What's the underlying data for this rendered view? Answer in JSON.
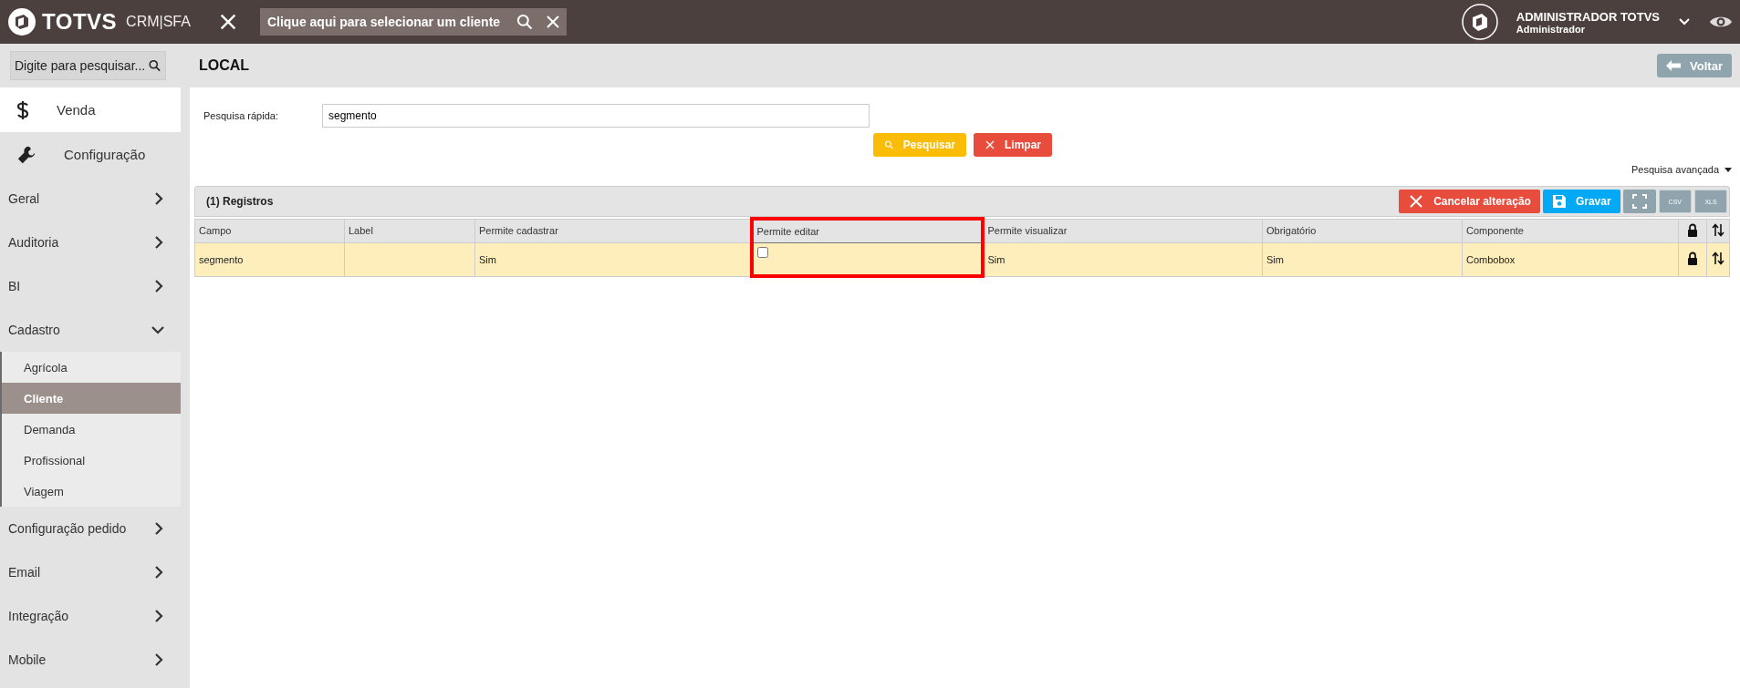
{
  "topbar": {
    "brand": "TOTVS",
    "product": "CRM|SFA",
    "client_search": {
      "placeholder": "Clique aqui para selecionar um cliente"
    },
    "user": {
      "name": "ADMINISTRADOR TOTVS",
      "role": "Administrador"
    }
  },
  "sidebar": {
    "search": {
      "placeholder": "Digite para pesquisar..."
    },
    "modules": [
      {
        "label": "Venda",
        "kind": "dollar",
        "selected": false
      },
      {
        "label": "Configuração",
        "kind": "wrench",
        "selected": true
      }
    ],
    "menu": [
      {
        "label": "Geral",
        "expanded": false
      },
      {
        "label": "Auditoria",
        "expanded": false
      },
      {
        "label": "BI",
        "expanded": false
      },
      {
        "label": "Cadastro",
        "expanded": true,
        "children": [
          {
            "label": "Agrícola",
            "selected": false
          },
          {
            "label": "Cliente",
            "selected": true
          },
          {
            "label": "Demanda",
            "selected": false
          },
          {
            "label": "Profissional",
            "selected": false
          },
          {
            "label": "Viagem",
            "selected": false
          }
        ]
      },
      {
        "label": "Configuração pedido",
        "expanded": false
      },
      {
        "label": "Email",
        "expanded": false
      },
      {
        "label": "Integração",
        "expanded": false
      },
      {
        "label": "Mobile",
        "expanded": false
      }
    ]
  },
  "page": {
    "title": "LOCAL",
    "back_button": "Voltar",
    "quick_search": {
      "label": "Pesquisa rápida:",
      "value": "segmento",
      "buttons": [
        {
          "label": "Pesquisar",
          "kind": "search"
        },
        {
          "label": "Limpar",
          "kind": "clear"
        }
      ]
    },
    "advanced_search": "Pesquisa avançada",
    "grid": {
      "title": "(1) Registros",
      "toolbar": [
        {
          "kind": "cancel",
          "label": "Cancelar alteração"
        },
        {
          "kind": "save",
          "label": "Gravar"
        },
        {
          "kind": "fullscreen"
        },
        {
          "kind": "csv",
          "label": "CSV"
        },
        {
          "kind": "xls",
          "label": "XLS"
        }
      ],
      "columns": [
        {
          "label": "Campo",
          "highlighted": false
        },
        {
          "label": "Label",
          "highlighted": false
        },
        {
          "label": "Permite cadastrar",
          "highlighted": false
        },
        {
          "label": "Permite editar",
          "highlighted": true
        },
        {
          "label": "Permite visualizar",
          "highlighted": false
        },
        {
          "label": "Obrigatório",
          "highlighted": false
        },
        {
          "label": "Componente",
          "highlighted": false
        }
      ],
      "rows": [
        {
          "cells": [
            {
              "kind": "text",
              "text": "segmento"
            },
            {
              "kind": "text"
            },
            {
              "kind": "text",
              "text": "Sim"
            },
            {
              "kind": "checkbox",
              "checked": false
            },
            {
              "kind": "text",
              "text": "Sim"
            },
            {
              "kind": "text",
              "text": "Sim"
            },
            {
              "kind": "text",
              "text": "Combobox"
            }
          ]
        }
      ]
    }
  }
}
